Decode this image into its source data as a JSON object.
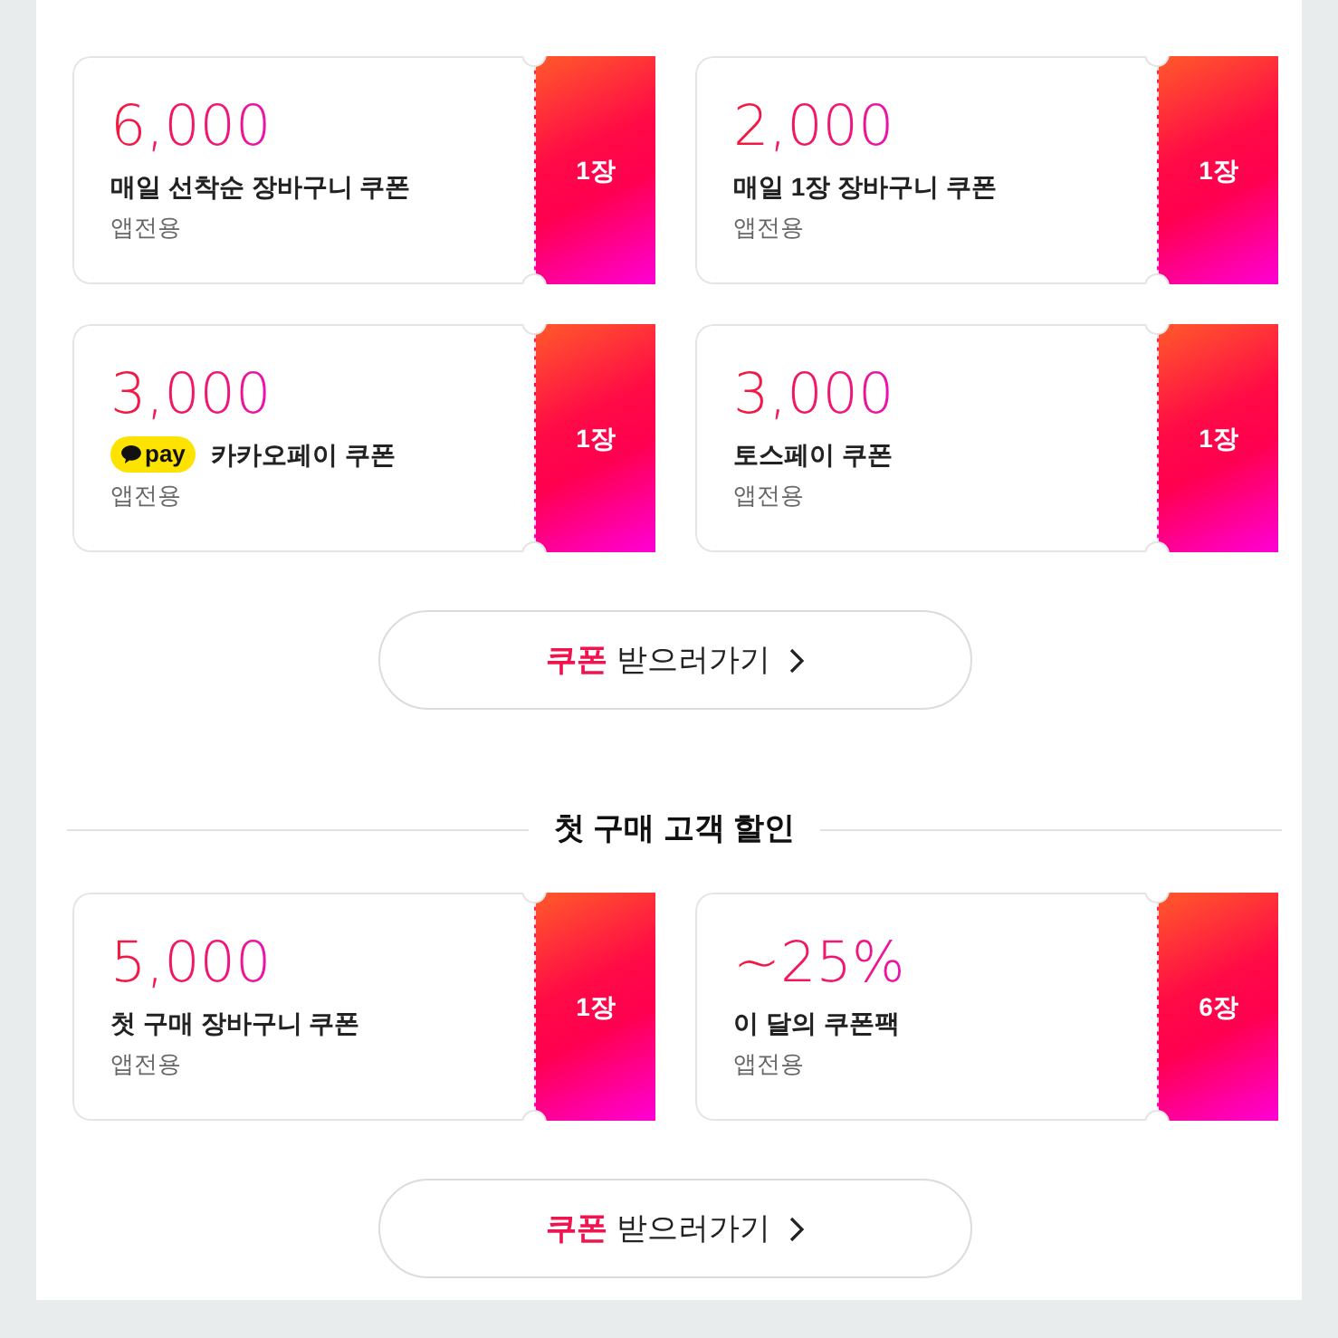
{
  "sections": [
    {
      "coupons": [
        {
          "amount": "6,000",
          "name": "매일 선착순 장바구니 쿠폰",
          "note": "앱전용",
          "count": "1장"
        },
        {
          "amount": "2,000",
          "name": "매일 1장 장바구니 쿠폰",
          "note": "앱전용",
          "count": "1장"
        },
        {
          "amount": "3,000",
          "badge": "pay",
          "name": "카카오페이 쿠폰",
          "note": "앱전용",
          "count": "1장"
        },
        {
          "amount": "3,000",
          "name": "토스페이 쿠폰",
          "note": "앱전용",
          "count": "1장"
        }
      ],
      "button": {
        "highlight": "쿠폰",
        "label": "받으러가기"
      }
    },
    {
      "title": "첫 구매 고객 할인",
      "coupons": [
        {
          "amount": "5,000",
          "name": "첫 구매 장바구니 쿠폰",
          "note": "앱전용",
          "count": "1장"
        },
        {
          "amount": "~25%",
          "name": "이 달의 쿠폰팩",
          "note": "앱전용",
          "count": "6장"
        }
      ],
      "button": {
        "highlight": "쿠폰",
        "label": "받으러가기"
      }
    }
  ]
}
